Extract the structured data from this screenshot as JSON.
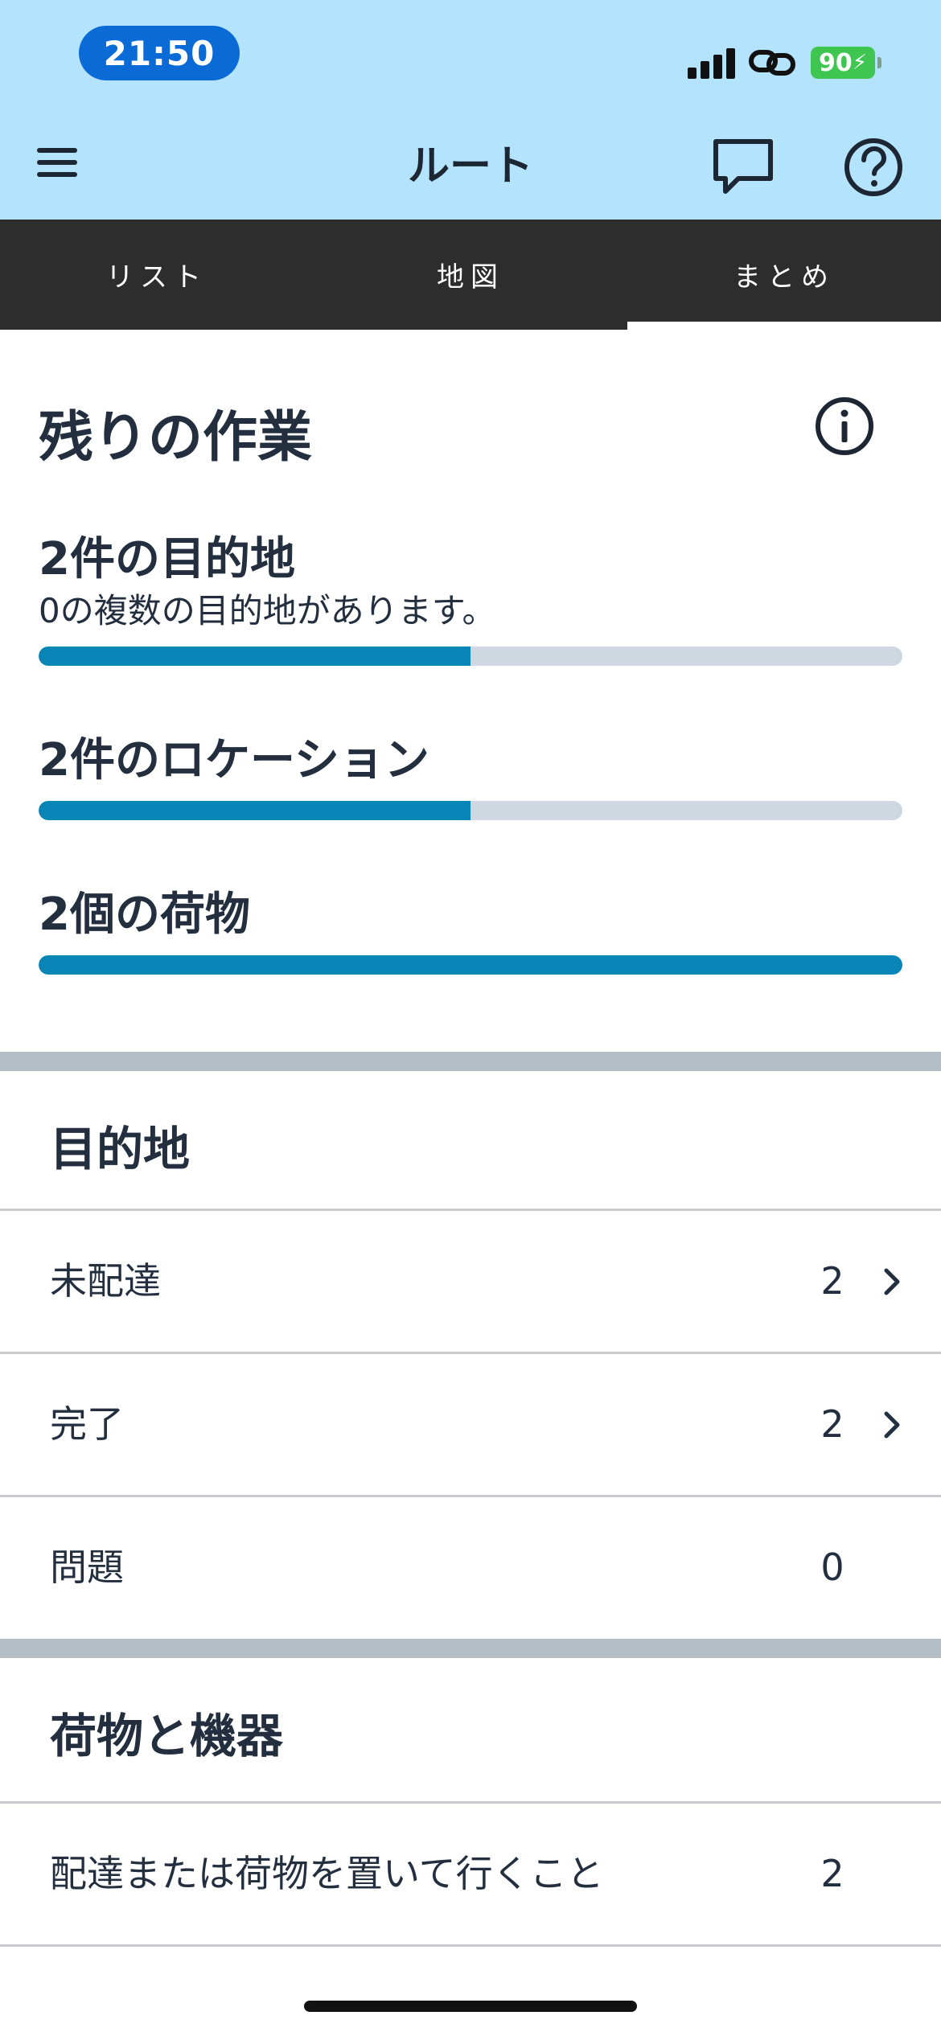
{
  "status_bar": {
    "time": "21:50",
    "battery": "90",
    "icons": [
      "signal-icon",
      "link-icon",
      "battery-icon"
    ]
  },
  "header": {
    "title": "ルート",
    "icons": [
      "menu-icon",
      "chat-icon",
      "help-icon"
    ]
  },
  "tabs": [
    {
      "label": "リスト",
      "active": false
    },
    {
      "label": "地図",
      "active": false
    },
    {
      "label": "まとめ",
      "active": true
    }
  ],
  "remaining_work": {
    "title": "残りの作業",
    "info_icon": "info-icon",
    "metrics": [
      {
        "label": "2件の目的地",
        "sub": "0の複数の目的地があります。",
        "progress": 0.5
      },
      {
        "label": "2件のロケーション",
        "progress": 0.5
      },
      {
        "label": "2個の荷物",
        "progress": 1.0
      }
    ]
  },
  "destinations": {
    "title": "目的地",
    "rows": [
      {
        "label": "未配達",
        "count": "2",
        "chevron": true
      },
      {
        "label": "完了",
        "count": "2",
        "chevron": true
      },
      {
        "label": "問題",
        "count": "0",
        "chevron": false
      }
    ]
  },
  "packages": {
    "title": "荷物と機器",
    "rows": [
      {
        "label": "配達または荷物を置いて行くこと",
        "count": "2",
        "chevron": false
      }
    ]
  },
  "colors": {
    "header_bg": "#b4e3fd",
    "time_pill": "#0a6bd6",
    "tab_bar": "#2d2d2d",
    "progress_fill": "#0a85b8",
    "progress_track": "#cfd8e1",
    "section_divider": "#b2bdc6",
    "text": "#232f3e",
    "battery": "#3ec651"
  }
}
